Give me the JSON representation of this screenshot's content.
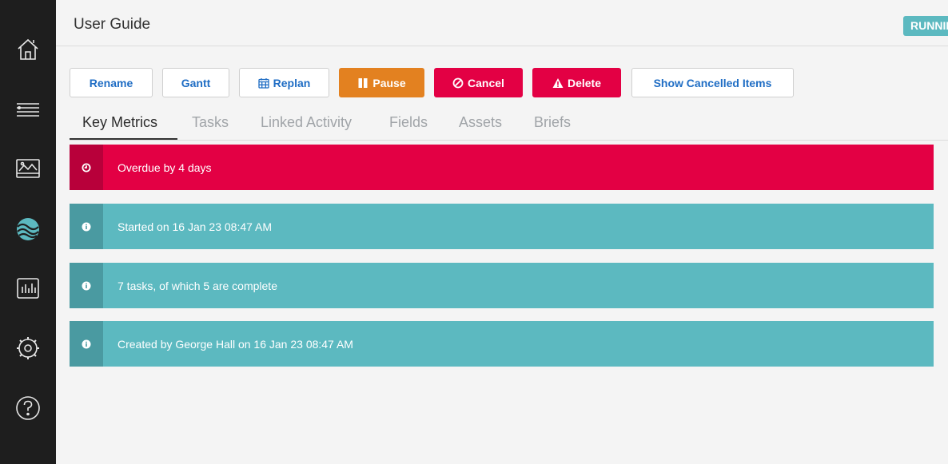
{
  "header": {
    "title": "User Guide",
    "status": "RUNNING"
  },
  "sidebar": {
    "items": [
      {
        "icon": "home-icon"
      },
      {
        "icon": "list-icon"
      },
      {
        "icon": "image-icon"
      },
      {
        "icon": "brand-logo-icon"
      },
      {
        "icon": "chart-icon"
      },
      {
        "icon": "gear-icon"
      },
      {
        "icon": "help-icon"
      }
    ]
  },
  "toolbar": {
    "rename_label": "Rename",
    "gantt_label": "Gantt",
    "replan_label": "Replan",
    "pause_label": "Pause",
    "cancel_label": "Cancel",
    "delete_label": "Delete",
    "show_cancelled_label": "Show Cancelled Items"
  },
  "tabs": [
    {
      "label": "Key Metrics",
      "active": true
    },
    {
      "label": "Tasks",
      "active": false
    },
    {
      "label": "Linked Activity",
      "active": false
    },
    {
      "label": "Fields",
      "active": false
    },
    {
      "label": "Assets",
      "active": false
    },
    {
      "label": "Briefs",
      "active": false
    }
  ],
  "metrics": [
    {
      "text": "Overdue by 4 days",
      "kind": "danger",
      "icon": "clock-icon"
    },
    {
      "text": "Started on 16 Jan 23 08:47 AM",
      "kind": "info",
      "icon": "info-icon"
    },
    {
      "text": "7 tasks, of which 5 are complete",
      "kind": "info",
      "icon": "info-icon"
    },
    {
      "text": "Created by George Hall on 16 Jan 23 08:47 AM",
      "kind": "info",
      "icon": "info-icon"
    }
  ],
  "colors": {
    "sidebar": "#1e1e1e",
    "accent_blue": "#1f6dc4",
    "danger": "#e30044",
    "warning": "#e38120",
    "info": "#5cb9c0"
  }
}
